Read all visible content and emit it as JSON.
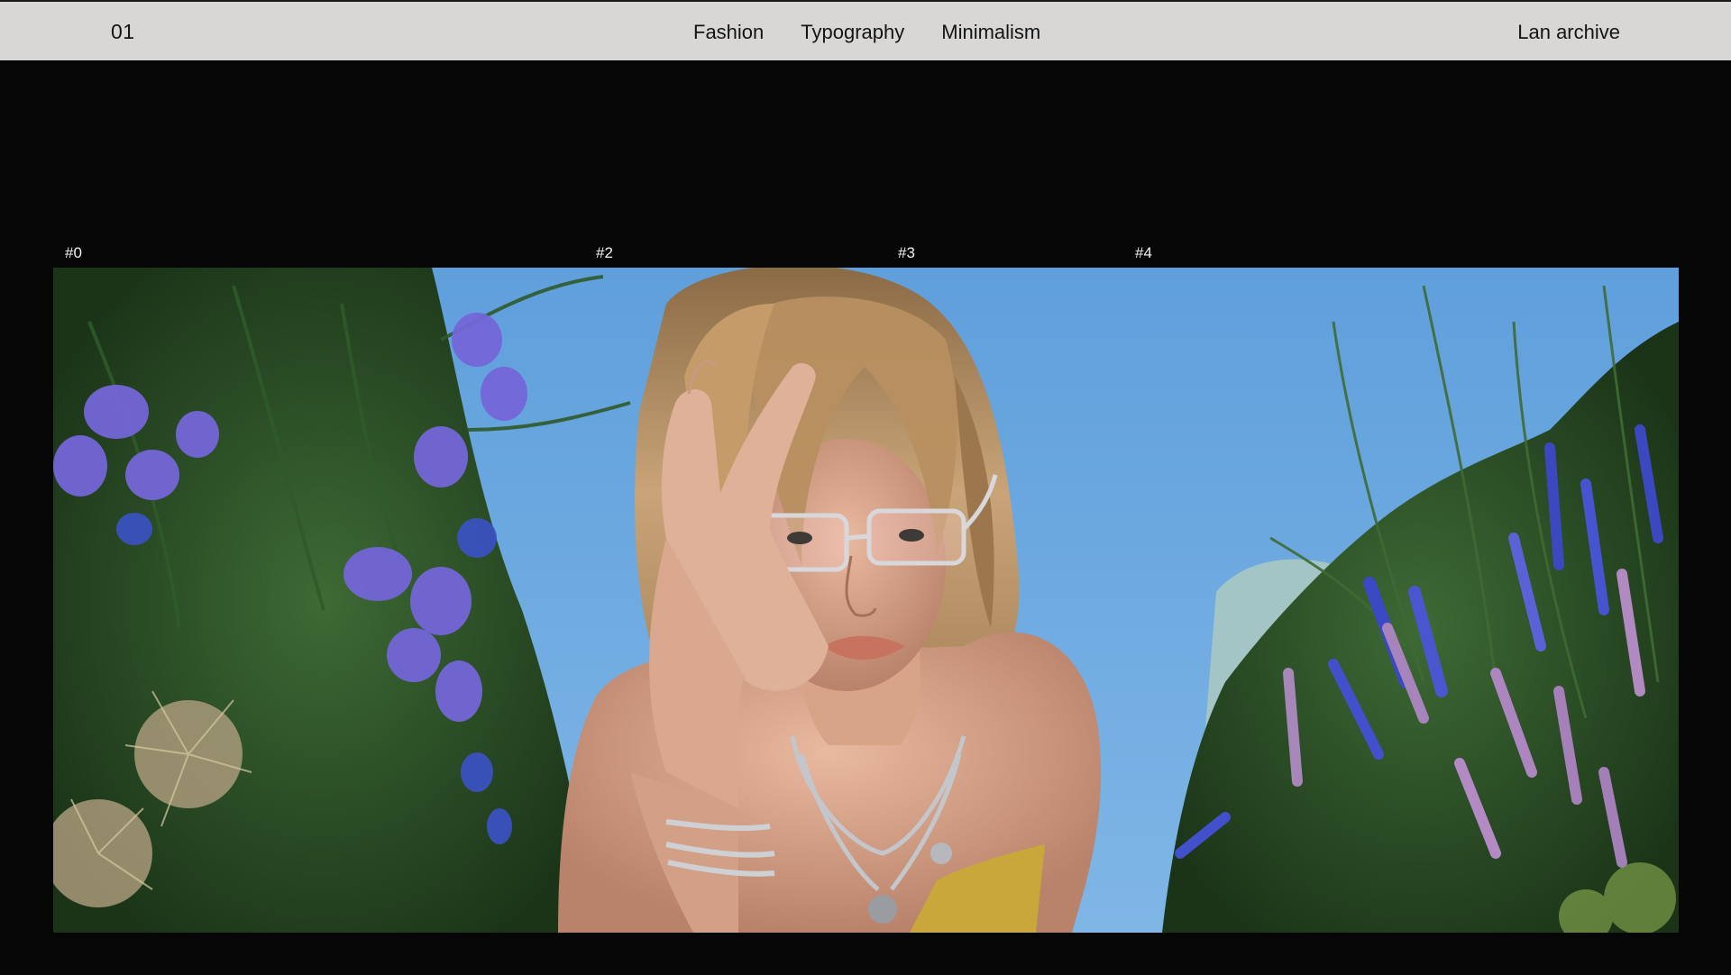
{
  "header": {
    "index": "01",
    "nav": [
      {
        "label": "Fashion"
      },
      {
        "label": "Typography"
      },
      {
        "label": "Minimalism"
      }
    ],
    "archive_link": "Lan archive"
  },
  "markers": [
    "#0",
    "#2",
    "#3",
    "#4"
  ],
  "colors": {
    "header_bg": "#d8d7d5",
    "page_bg": "#060607",
    "sky": "#6ba7dd"
  }
}
